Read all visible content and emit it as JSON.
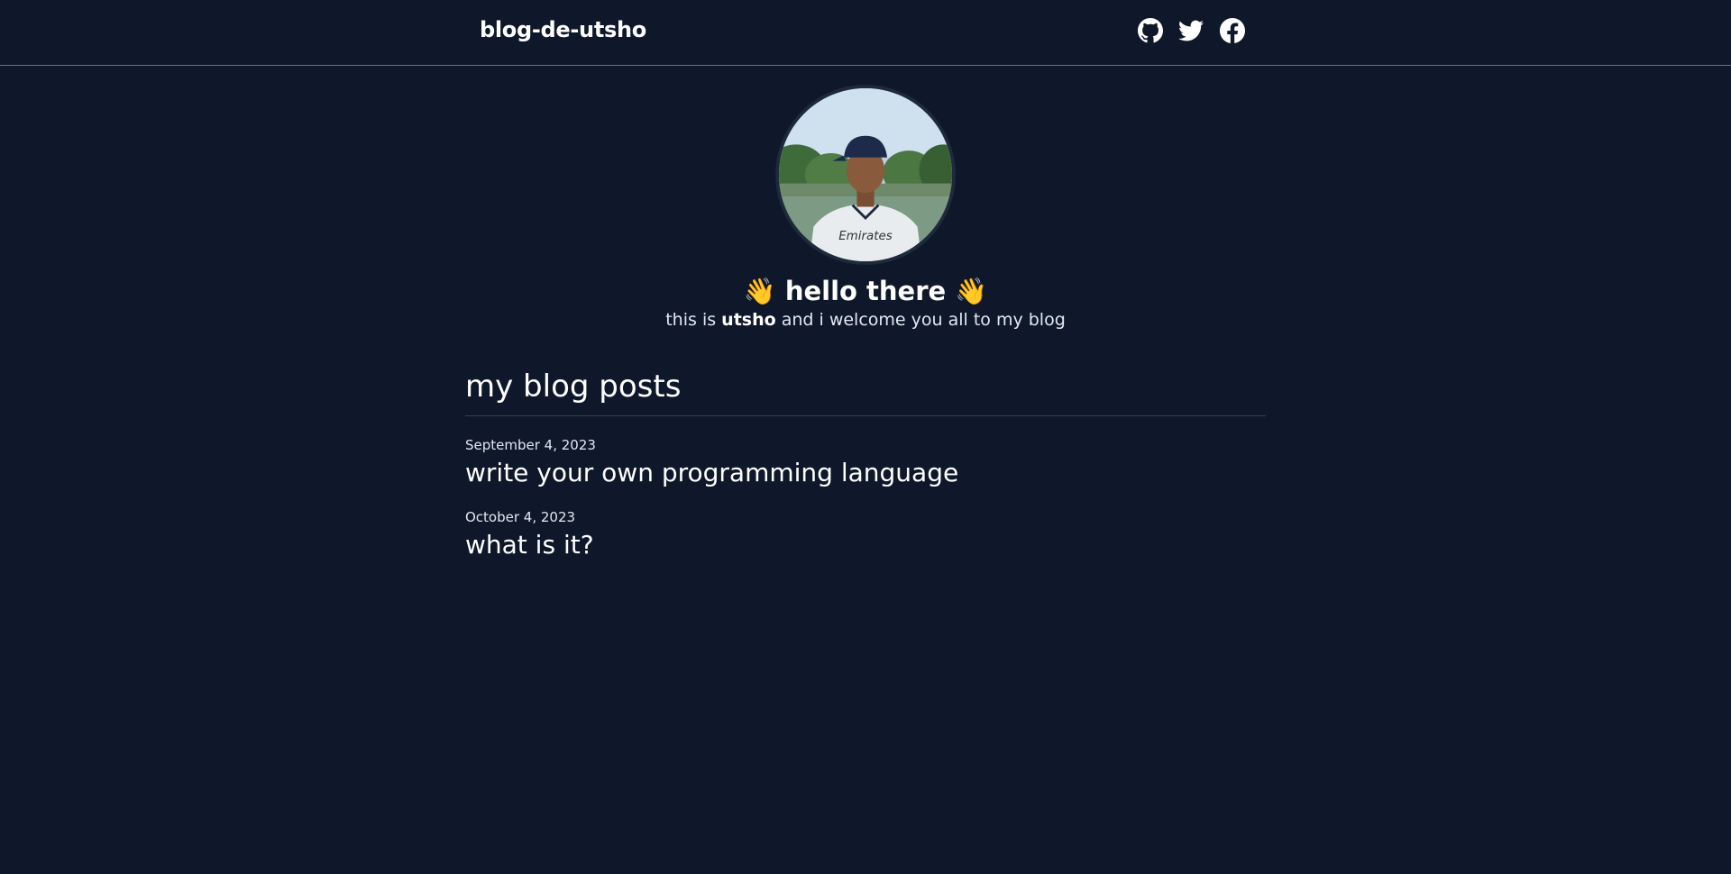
{
  "navbar": {
    "brand": "blog-de-utsho",
    "social_icons": [
      "github-icon",
      "twitter-icon",
      "facebook-icon"
    ]
  },
  "hero": {
    "avatar": "profile-photo",
    "wave_emoji": "👋",
    "greeting": "hello there",
    "intro_prefix": "this is",
    "intro_name": "utsho",
    "intro_suffix": "and i welcome you all to my blog"
  },
  "posts_section": {
    "title": "my blog posts",
    "posts": [
      {
        "date": "September 4, 2023",
        "title": "write your own programming language"
      },
      {
        "date": "October 4, 2023",
        "title": "what is it?"
      }
    ]
  },
  "colors": {
    "background": "#0f172a",
    "text": "#ffffff",
    "muted_text": "#e2e8f0",
    "divider": "#334155",
    "nav_border": "#64748b"
  }
}
